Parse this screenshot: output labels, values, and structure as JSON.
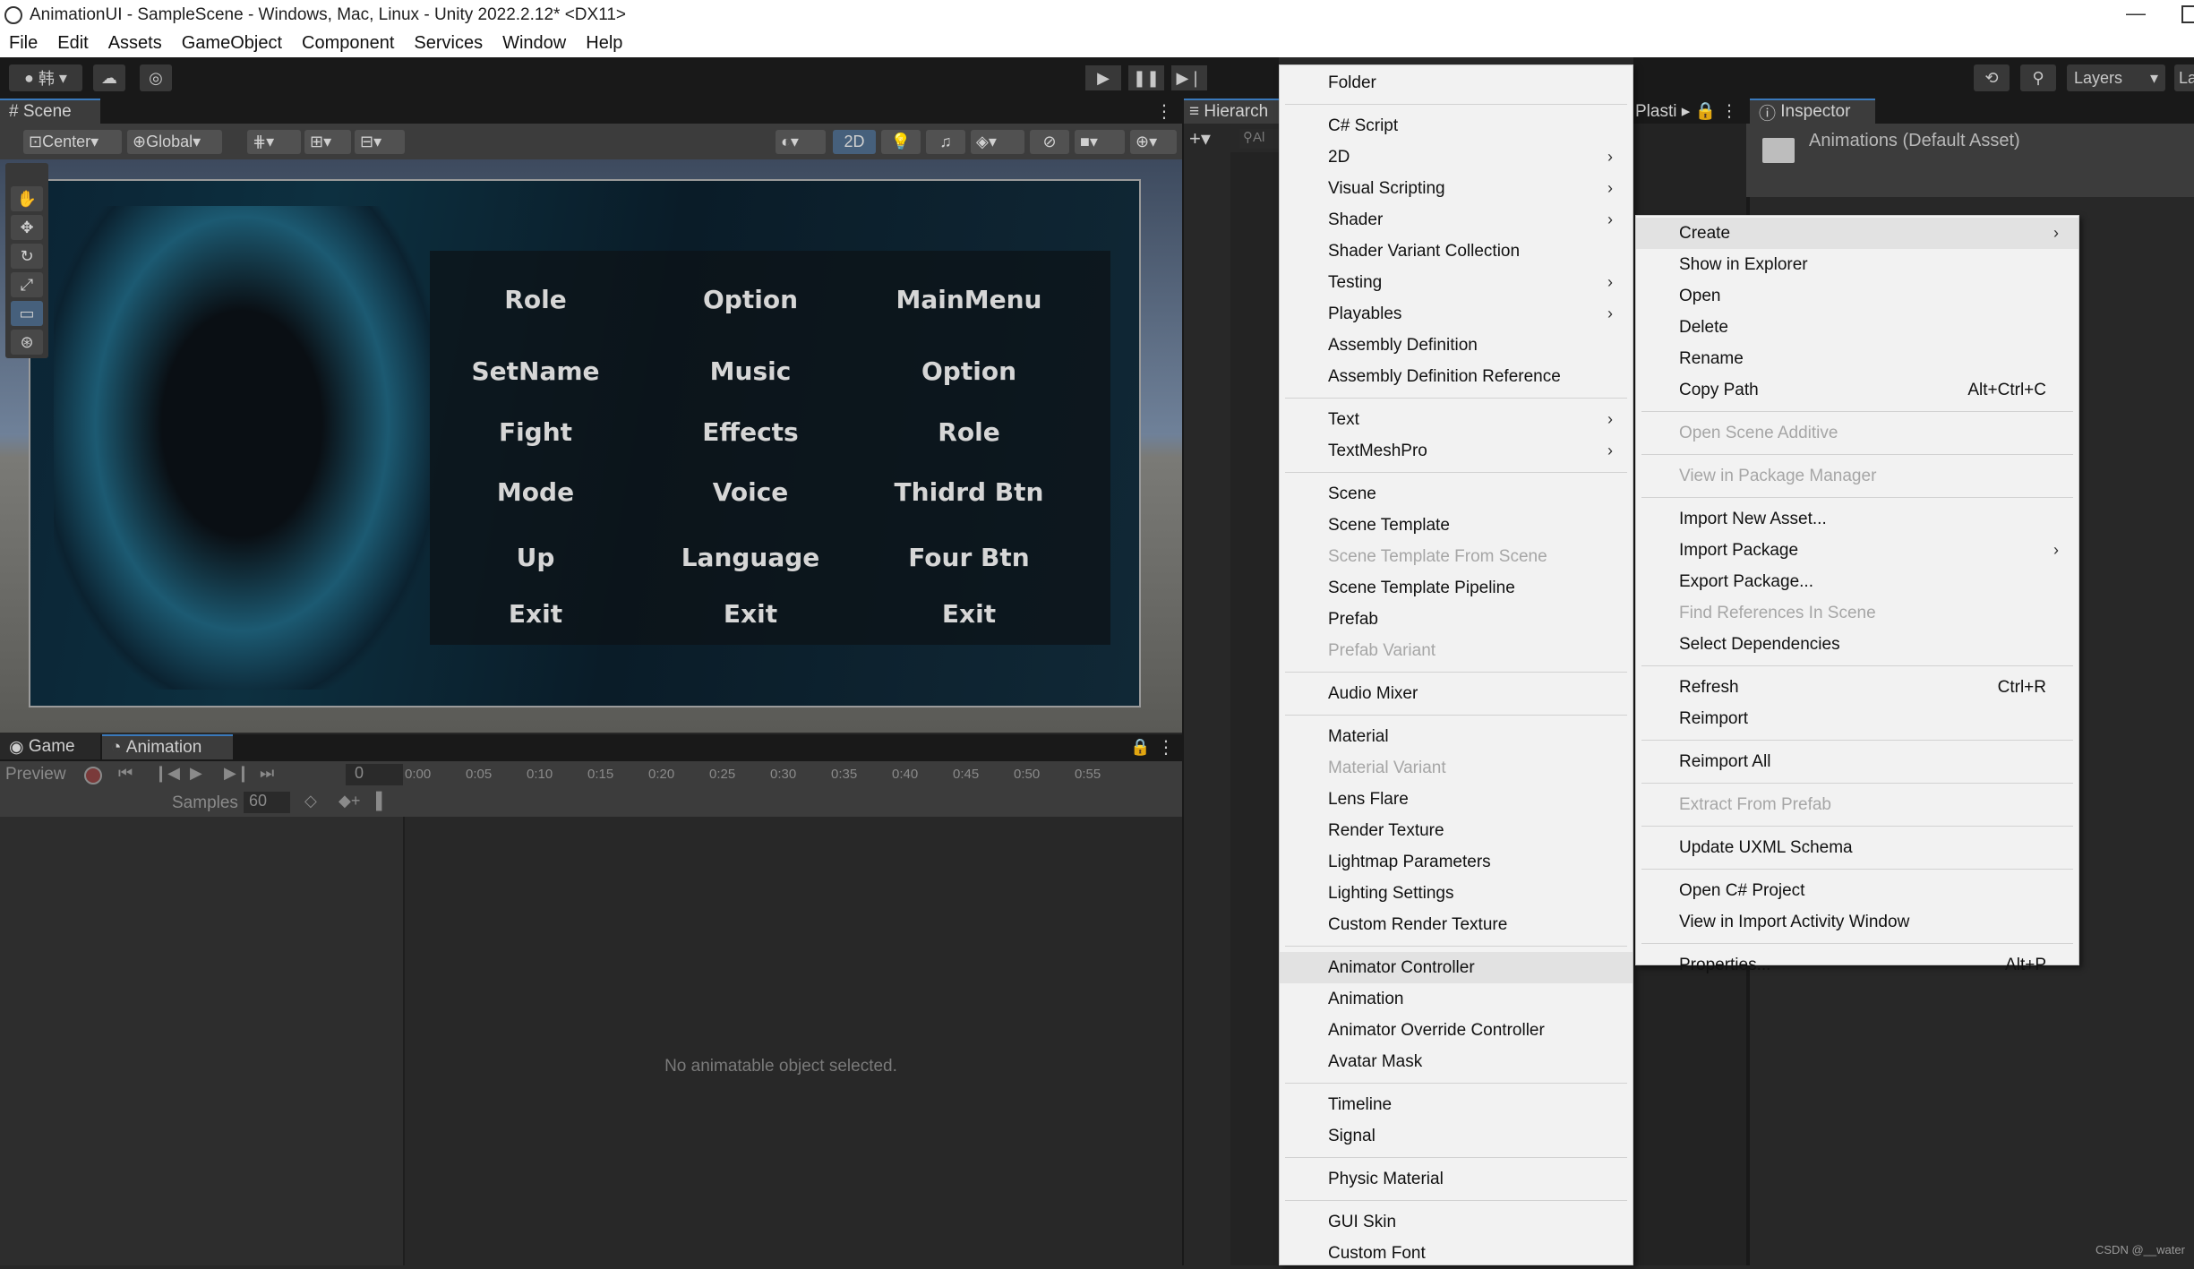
{
  "window": {
    "title": "AnimationUI - SampleScene - Windows, Mac, Linux - Unity 2022.2.12* <DX11>",
    "minimize": "—"
  },
  "menubar": [
    "File",
    "Edit",
    "Assets",
    "GameObject",
    "Component",
    "Services",
    "Window",
    "Help"
  ],
  "toolbar": {
    "account": "韩",
    "layers": "Layers",
    "layout": "La"
  },
  "scene": {
    "tab": "Scene",
    "pivot": "Center",
    "space": "Global",
    "mode2d": "2D",
    "buttons": [
      [
        "Role",
        "Option",
        "MainMenu"
      ],
      [
        "SetName",
        "Music",
        "Option"
      ],
      [
        "Fight",
        "Effects",
        "Role"
      ],
      [
        "Mode",
        "Voice",
        "Thidrd Btn"
      ],
      [
        "Up",
        "Language",
        "Four Btn"
      ],
      [
        "Exit",
        "Exit",
        "Exit"
      ]
    ]
  },
  "animation": {
    "tab_game": "Game",
    "tab_animation": "Animation",
    "preview": "Preview",
    "frame": "0",
    "samples_label": "Samples",
    "samples_value": "60",
    "ticks": [
      "0:00",
      "0:05",
      "0:10",
      "0:15",
      "0:20",
      "0:25",
      "0:30",
      "0:35",
      "0:40",
      "0:45",
      "0:50",
      "0:55"
    ],
    "empty": "No animatable object selected."
  },
  "hierarchy": {
    "tab": "Hierarch",
    "search": "Al"
  },
  "plastic": {
    "tab": "Plasti"
  },
  "inspector": {
    "tab": "Inspector",
    "asset": "Animations (Default Asset)"
  },
  "create_menu": [
    {
      "label": "Folder"
    },
    {
      "sep": true
    },
    {
      "label": "C# Script"
    },
    {
      "label": "2D",
      "arrow": true
    },
    {
      "label": "Visual Scripting",
      "arrow": true
    },
    {
      "label": "Shader",
      "arrow": true
    },
    {
      "label": "Shader Variant Collection"
    },
    {
      "label": "Testing",
      "arrow": true
    },
    {
      "label": "Playables",
      "arrow": true
    },
    {
      "label": "Assembly Definition"
    },
    {
      "label": "Assembly Definition Reference"
    },
    {
      "sep": true
    },
    {
      "label": "Text",
      "arrow": true
    },
    {
      "label": "TextMeshPro",
      "arrow": true
    },
    {
      "sep": true
    },
    {
      "label": "Scene"
    },
    {
      "label": "Scene Template"
    },
    {
      "label": "Scene Template From Scene",
      "disabled": true
    },
    {
      "label": "Scene Template Pipeline"
    },
    {
      "label": "Prefab"
    },
    {
      "label": "Prefab Variant",
      "disabled": true
    },
    {
      "sep": true
    },
    {
      "label": "Audio Mixer"
    },
    {
      "sep": true
    },
    {
      "label": "Material"
    },
    {
      "label": "Material Variant",
      "disabled": true
    },
    {
      "label": "Lens Flare"
    },
    {
      "label": "Render Texture"
    },
    {
      "label": "Lightmap Parameters"
    },
    {
      "label": "Lighting Settings"
    },
    {
      "label": "Custom Render Texture"
    },
    {
      "sep": true
    },
    {
      "label": "Animator Controller",
      "highlight": true
    },
    {
      "label": "Animation"
    },
    {
      "label": "Animator Override Controller"
    },
    {
      "label": "Avatar Mask"
    },
    {
      "sep": true
    },
    {
      "label": "Timeline"
    },
    {
      "label": "Signal"
    },
    {
      "sep": true
    },
    {
      "label": "Physic Material"
    },
    {
      "sep": true
    },
    {
      "label": "GUI Skin"
    },
    {
      "label": "Custom Font"
    }
  ],
  "context_menu": [
    {
      "label": "Create",
      "arrow": true,
      "highlight": true
    },
    {
      "label": "Show in Explorer"
    },
    {
      "label": "Open"
    },
    {
      "label": "Delete"
    },
    {
      "label": "Rename"
    },
    {
      "label": "Copy Path",
      "shortcut": "Alt+Ctrl+C"
    },
    {
      "sep": true
    },
    {
      "label": "Open Scene Additive",
      "disabled": true
    },
    {
      "sep": true
    },
    {
      "label": "View in Package Manager",
      "disabled": true
    },
    {
      "sep": true
    },
    {
      "label": "Import New Asset..."
    },
    {
      "label": "Import Package",
      "arrow": true
    },
    {
      "label": "Export Package..."
    },
    {
      "label": "Find References In Scene",
      "disabled": true
    },
    {
      "label": "Select Dependencies"
    },
    {
      "sep": true
    },
    {
      "label": "Refresh",
      "shortcut": "Ctrl+R"
    },
    {
      "label": "Reimport"
    },
    {
      "sep": true
    },
    {
      "label": "Reimport All"
    },
    {
      "sep": true
    },
    {
      "label": "Extract From Prefab",
      "disabled": true
    },
    {
      "sep": true
    },
    {
      "label": "Update UXML Schema"
    },
    {
      "sep": true
    },
    {
      "label": "Open C# Project"
    },
    {
      "label": "View in Import Activity Window"
    },
    {
      "sep": true
    },
    {
      "label": "Properties...",
      "shortcut": "Alt+P"
    }
  ],
  "watermark": "CSDN @__water"
}
